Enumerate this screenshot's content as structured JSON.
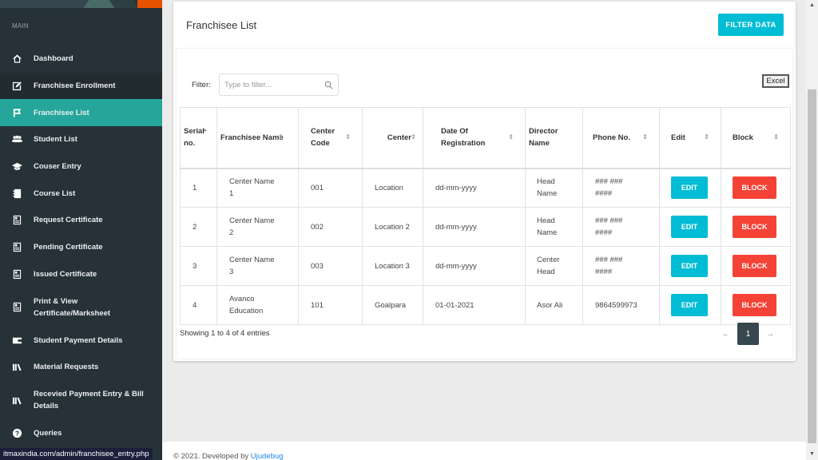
{
  "sidebar": {
    "section_label": "MAIN",
    "items": [
      {
        "label": "Dashboard",
        "icon": "home-icon"
      },
      {
        "label": "Franchisee Enrollment",
        "icon": "edit-square-icon"
      },
      {
        "label": "Franchisee List",
        "icon": "list-flag-icon"
      },
      {
        "label": "Student List",
        "icon": "users-icon"
      },
      {
        "label": "Couser Entry",
        "icon": "graduation-cap-icon"
      },
      {
        "label": "Course List",
        "icon": "notebook-icon"
      },
      {
        "label": "Request Certificate",
        "icon": "certificate-icon"
      },
      {
        "label": "Pending Certificate",
        "icon": "certificate-icon"
      },
      {
        "label": "Issued Certificate",
        "icon": "certificate-icon"
      },
      {
        "label": "Print & View Certificate/Marksheet",
        "icon": "certificate-icon"
      },
      {
        "label": "Student Payment Details",
        "icon": "wallet-icon"
      },
      {
        "label": "Material Requests",
        "icon": "books-icon"
      },
      {
        "label": "Recevied Payment Entry & Bill Details",
        "icon": "books-icon"
      },
      {
        "label": "Queries",
        "icon": "question-icon"
      }
    ],
    "active_index": 2
  },
  "status_bar_url": "itmaxindia.com/admin/franchisee_entry.php",
  "page": {
    "title": "Franchisee List",
    "filter_data_label": "FILTER DATA",
    "filter_label": "Filter:",
    "filter_placeholder": "Type to filter...",
    "filter_value": "",
    "excel_label": "Excel"
  },
  "table": {
    "columns": [
      {
        "label": "Serial no.",
        "sort": "asc"
      },
      {
        "label": "Franchisee Name",
        "sort": "none"
      },
      {
        "label": "Center Code",
        "sort": "none"
      },
      {
        "label": "Center",
        "sort": "none"
      },
      {
        "label": "Date Of Registration",
        "sort": "none"
      },
      {
        "label": "Director Name",
        "sort": null
      },
      {
        "label": "Phone No.",
        "sort": "none"
      },
      {
        "label": "Edit",
        "sort": "none"
      },
      {
        "label": "Block",
        "sort": "none"
      }
    ],
    "rows": [
      {
        "serial": "1",
        "name": "Center Name 1",
        "code": "001",
        "center": "Location",
        "date": "dd-mm-yyyy",
        "director": "Head Name",
        "phone": "### ### ####"
      },
      {
        "serial": "2",
        "name": "Center Name 2",
        "code": "002",
        "center": "Location 2",
        "date": "dd-mm-yyyy",
        "director": "Head Name",
        "phone": "### ### ####"
      },
      {
        "serial": "3",
        "name": "Center Name 3",
        "code": "003",
        "center": "Location 3",
        "date": "dd-mm-yyyy",
        "director": "Center Head",
        "phone": "### ### ####"
      },
      {
        "serial": "4",
        "name": "Avanco Education",
        "code": "101",
        "center": "Goalpara",
        "date": "01-01-2021",
        "director": "Asor Ali",
        "phone": "9864599973"
      }
    ],
    "edit_label": "EDIT",
    "block_label": "BLOCK"
  },
  "pagination": {
    "info": "Showing 1 to 4 of 4 entries",
    "prev": "←",
    "next": "→",
    "current_page": "1"
  },
  "footer": {
    "text": "© 2021. Developed by ",
    "link": "Ujudebug"
  },
  "colors": {
    "sidebar_bg": "#263238",
    "active_item": "#26a69a",
    "accent_cyan": "#00bcd4",
    "danger_red": "#f44336",
    "pager_active": "#37474f",
    "link_blue": "#1e88e5"
  }
}
